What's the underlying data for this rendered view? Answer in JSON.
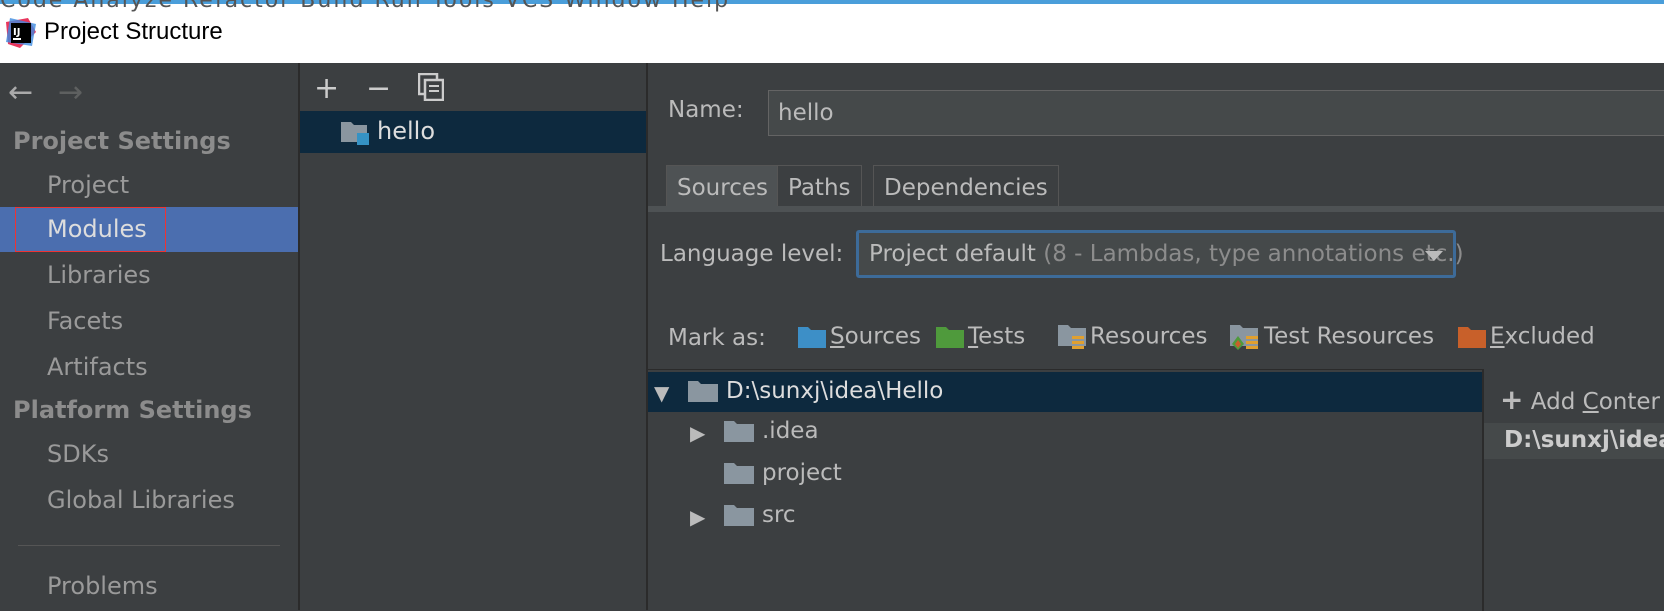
{
  "window": {
    "title": "Project Structure",
    "menu_strip": "Code  Analyze  Refactor  Build  Run  Tools  VCS  Window  Help"
  },
  "sidebar": {
    "back_label": "←",
    "forward_label": "→",
    "sections": [
      {
        "heading": "Project Settings",
        "items": [
          "Project",
          "Modules",
          "Libraries",
          "Facets",
          "Artifacts"
        ]
      },
      {
        "heading": "Platform Settings",
        "items": [
          "SDKs",
          "Global Libraries"
        ]
      }
    ],
    "bottom_item": "Problems",
    "active_item": "Modules"
  },
  "module_panel": {
    "add_label": "+",
    "remove_label": "−",
    "copy_label": "⧉",
    "modules": [
      "hello"
    ]
  },
  "detail": {
    "name_label": "Name:",
    "name_value": "hello",
    "tabs": [
      "Sources",
      "Paths",
      "Dependencies"
    ],
    "active_tab": "Sources",
    "language_level_label": "Language level:",
    "language_level_value": "Project default",
    "language_level_hint": "(8 - Lambdas, type annotations etc.)",
    "mark_as_label": "Mark as:",
    "mark_as": [
      {
        "mnemonic": "S",
        "rest": "ources",
        "color": "#3d8fc7"
      },
      {
        "mnemonic": "T",
        "rest": "ests",
        "color": "#4f9a3c"
      },
      {
        "mnemonic": "",
        "rest": "Resources",
        "color": "#8c8c8c"
      },
      {
        "mnemonic": "",
        "rest": "Test Resources",
        "color": "#8c8c8c"
      },
      {
        "mnemonic": "E",
        "rest": "xcluded",
        "color": "#c8602a"
      }
    ],
    "tree": {
      "root": "D:\\sunxj\\idea\\Hello",
      "children": [
        ".idea",
        "project",
        "src"
      ]
    },
    "content_roots": {
      "add_label": "Add Conte",
      "add_mnemonic": "C",
      "add_rest_before": "Add ",
      "add_rest_after": "onter",
      "root_path": "D:\\sunxj\\idea"
    }
  },
  "colors": {
    "accent": "#4b6eaf",
    "selection": "#0d293e",
    "folder": "#8a96a0"
  }
}
